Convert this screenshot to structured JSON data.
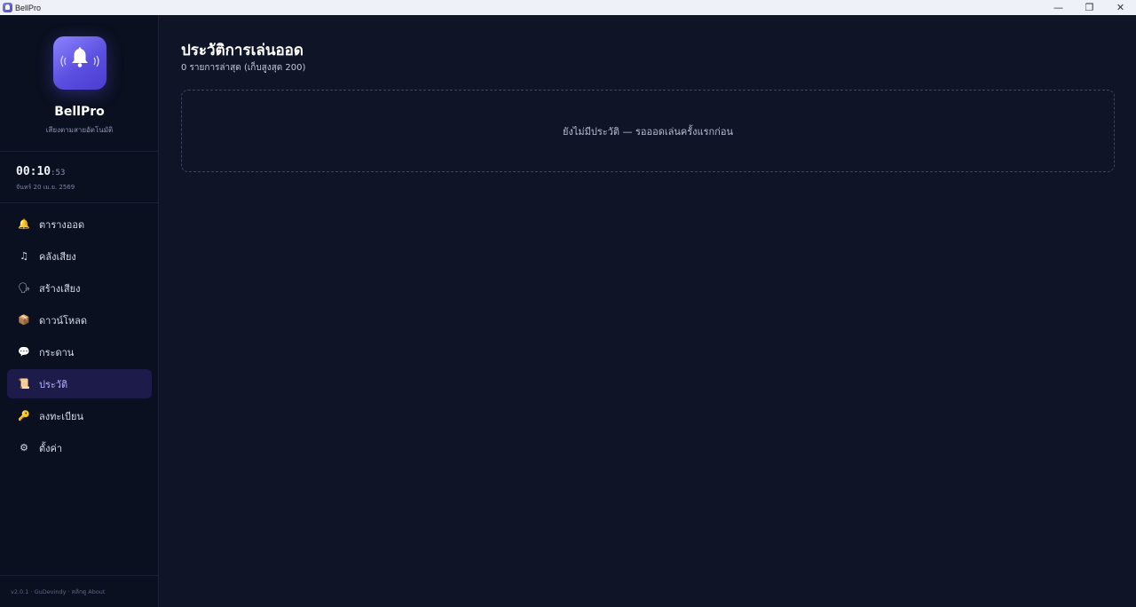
{
  "window": {
    "title": "BellPro",
    "minimize": "—",
    "restore": "❐",
    "close": "✕"
  },
  "sidebar": {
    "brand": "BellPro",
    "tagline": "เสียงตามสายอัตโนมัติ",
    "clock": {
      "hm": "00:10",
      "sec": ":53"
    },
    "date": "จันทร์ 20 เม.ย. 2569",
    "items": [
      {
        "label": "ตารางออด",
        "icon": "bell-icon",
        "glyph": "🔔",
        "active": false
      },
      {
        "label": "คลังเสียง",
        "icon": "music-note-icon",
        "glyph": "♫",
        "active": false
      },
      {
        "label": "สร้างเสียง",
        "icon": "speaking-head-icon",
        "glyph": "🗣",
        "active": false
      },
      {
        "label": "ดาวน์โหลด",
        "icon": "package-icon",
        "glyph": "📦",
        "active": false
      },
      {
        "label": "กระดาน",
        "icon": "speech-bubble-icon",
        "glyph": "💬",
        "active": false
      },
      {
        "label": "ประวัติ",
        "icon": "scroll-icon",
        "glyph": "📜",
        "active": true
      },
      {
        "label": "ลงทะเบียน",
        "icon": "key-icon",
        "glyph": "🔑",
        "active": false
      },
      {
        "label": "ตั้งค่า",
        "icon": "gear-icon",
        "glyph": "⚙",
        "active": false
      }
    ],
    "version": "v2.0.1 · GuDevindy · คลิกดู About"
  },
  "main": {
    "title": "ประวัติการเล่นออด",
    "subtitle": "0 รายการล่าสุด (เก็บสูงสุด 200)",
    "empty_message": "ยังไม่มีประวัติ — รอออดเล่นครั้งแรกก่อน"
  },
  "colors": {
    "background": "#0f1526",
    "sidebar": "#0b1020",
    "accent": "#6a5cf0",
    "active_item_bg": "#1c1b4a"
  }
}
